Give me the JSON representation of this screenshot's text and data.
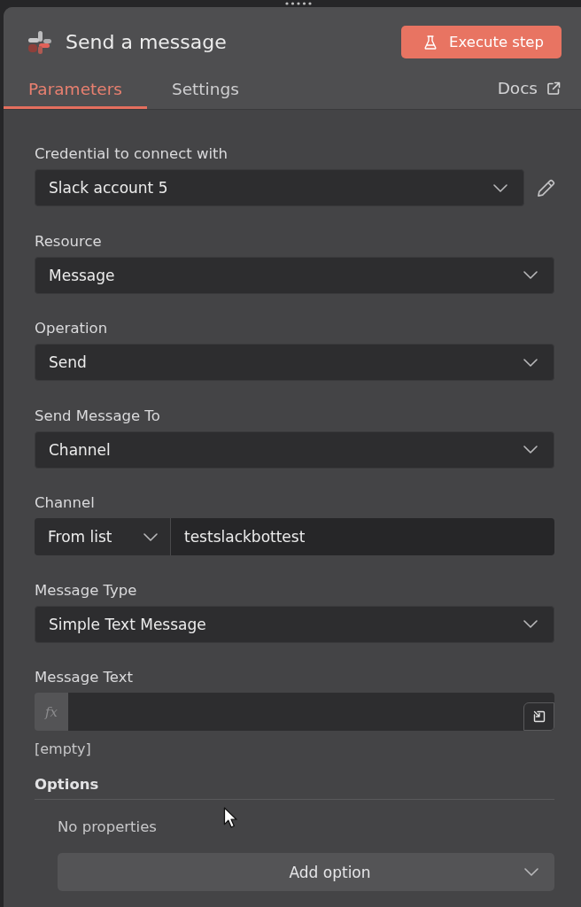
{
  "header": {
    "title": "Send a message",
    "execute_button": "Execute step"
  },
  "tabs": [
    {
      "label": "Parameters",
      "selected": true
    },
    {
      "label": "Settings",
      "selected": false
    }
  ],
  "docs_link": "Docs",
  "fields": [
    {
      "kind": "credential",
      "label": "Credential to connect with",
      "value": "Slack account 5"
    },
    {
      "kind": "select",
      "label": "Resource",
      "value": "Message"
    },
    {
      "kind": "select",
      "label": "Operation",
      "value": "Send"
    },
    {
      "kind": "select",
      "label": "Send Message To",
      "value": "Channel"
    },
    {
      "kind": "locator",
      "label": "Channel",
      "mode": "From list",
      "value": "testslackbottest"
    },
    {
      "kind": "select",
      "label": "Message Type",
      "value": "Simple Text Message"
    },
    {
      "kind": "expression",
      "label": "Message Text",
      "prefix": "fx",
      "hint": "[empty]"
    }
  ],
  "options": {
    "label": "Options",
    "empty_text": "No properties",
    "add_button": "Add option"
  }
}
